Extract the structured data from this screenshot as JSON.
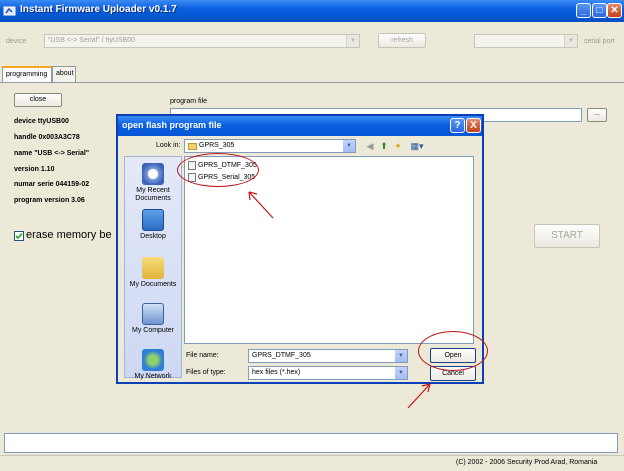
{
  "window": {
    "title": "Instant Firmware Uploader v0.1.7",
    "controls": [
      "minimize",
      "maximize",
      "close"
    ]
  },
  "toolbar": {
    "device_label": "device",
    "device_value": "\"USB <-> Serial\" / ttyUSB00",
    "refresh_label": "refresh",
    "serial_port_label": "serial port",
    "serial_port_value": ""
  },
  "tabs": [
    {
      "label": "programming",
      "active": true
    },
    {
      "label": "about",
      "active": false
    }
  ],
  "programming": {
    "close_label": "close",
    "program_file_label": "program file",
    "browse_label": "...",
    "info": [
      "device ttyUSB00",
      "handle 0x003A3C78",
      "name \"USB <-> Serial\"",
      "version 1.10",
      "numar serie 044159-02",
      "program version 3.06"
    ],
    "erase_label": "erase memory be",
    "erase_checked": true,
    "start_label": "START"
  },
  "status": {
    "copyright": "(C) 2002 - 2006 Security Prod Arad, Romania"
  },
  "dialog": {
    "title": "open flash program file",
    "help_label": "?",
    "close_label": "X",
    "look_in_label": "Look in:",
    "look_in_value": "GPRS_305",
    "places": [
      {
        "label": "My Recent Documents",
        "icon": "recent-documents-icon"
      },
      {
        "label": "Desktop",
        "icon": "desktop-icon"
      },
      {
        "label": "My Documents",
        "icon": "my-documents-icon"
      },
      {
        "label": "My Computer",
        "icon": "my-computer-icon"
      },
      {
        "label": "My Network",
        "icon": "my-network-icon"
      }
    ],
    "files": [
      "GPRS_DTMF_305",
      "GPRS_Serial_305"
    ],
    "file_name_label": "File name:",
    "file_name_value": "GPRS_DTMF_305",
    "files_of_type_label": "Files of type:",
    "files_of_type_value": "hex files (*.hex)",
    "open_label": "Open",
    "cancel_label": "Cancel"
  },
  "colors": {
    "xp_blue": "#0558d4",
    "annotation_red": "#c0151a",
    "face": "#ece9d8"
  }
}
